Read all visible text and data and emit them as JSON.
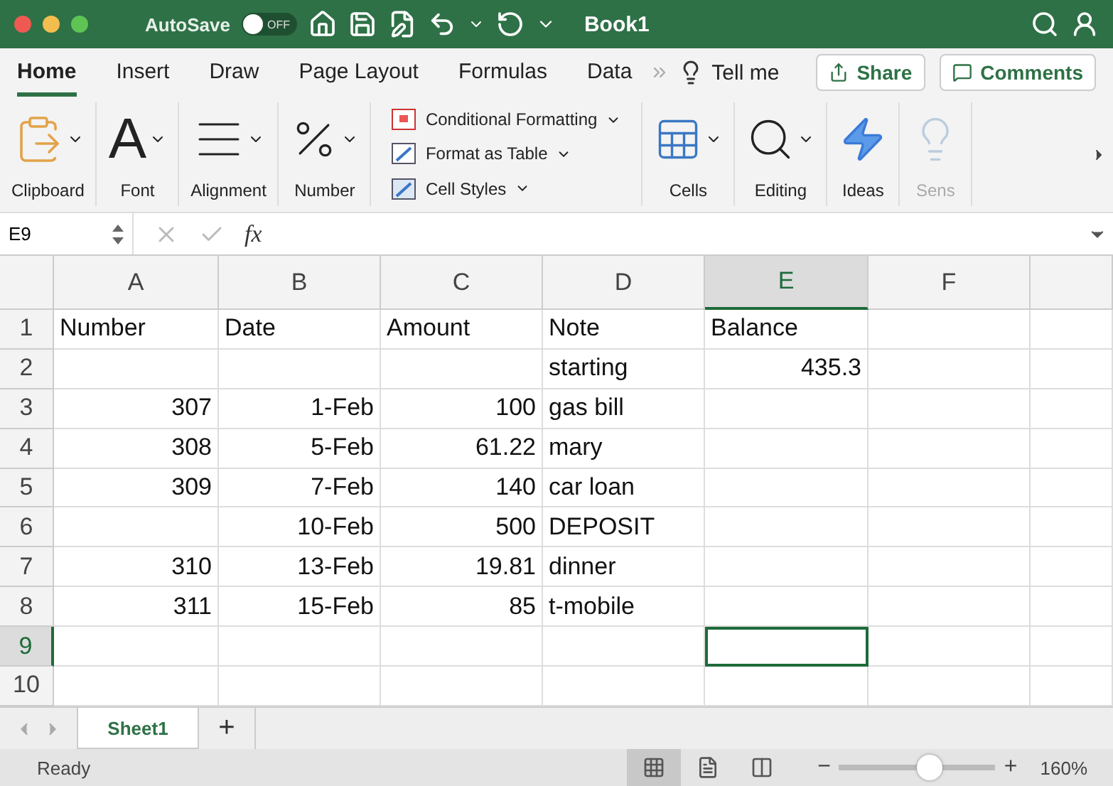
{
  "title_bar": {
    "autosave_label": "AutoSave",
    "autosave_toggle": {
      "label": "OFF",
      "on": false
    },
    "title": "Book1"
  },
  "menu_tabs": [
    {
      "label": "Home",
      "selected": true
    },
    {
      "label": "Insert",
      "selected": false
    },
    {
      "label": "Draw",
      "selected": false
    },
    {
      "label": "Page Layout",
      "selected": false
    },
    {
      "label": "Formulas",
      "selected": false
    },
    {
      "label": "Data",
      "selected": false
    }
  ],
  "tell_me": "Tell me",
  "share_button": "Share",
  "comments_button": "Comments",
  "ribbon": {
    "left_groups": [
      {
        "label": "Clipboard",
        "kind": "clipboard",
        "disabled": false
      },
      {
        "label": "Font",
        "kind": "font",
        "glyph": "A",
        "disabled": false
      },
      {
        "label": "Alignment",
        "kind": "alignment",
        "disabled": false
      },
      {
        "label": "Number",
        "kind": "number",
        "disabled": false
      }
    ],
    "styles": [
      {
        "label": "Conditional Formatting",
        "kind": "conditional"
      },
      {
        "label": "Format as Table",
        "kind": "table"
      },
      {
        "label": "Cell Styles",
        "kind": "styles"
      }
    ],
    "right_groups": [
      {
        "label": "Cells",
        "kind": "cells",
        "disabled": false
      },
      {
        "label": "Editing",
        "kind": "editing",
        "disabled": false
      },
      {
        "label": "Ideas",
        "kind": "ideas",
        "disabled": false
      },
      {
        "label": "Sens",
        "kind": "sens",
        "disabled": true
      }
    ]
  },
  "formula_bar": {
    "name_box": "E9",
    "fx": "fx"
  },
  "sheet": {
    "columns": [
      {
        "label": "A",
        "selected": false
      },
      {
        "label": "B",
        "selected": false
      },
      {
        "label": "C",
        "selected": false
      },
      {
        "label": "D",
        "selected": false
      },
      {
        "label": "E",
        "selected": true
      },
      {
        "label": "F",
        "selected": false
      }
    ],
    "rows": [
      {
        "label": "1",
        "selected": false,
        "cells": [
          {
            "text": "Number",
            "kind": "text",
            "selected": false
          },
          {
            "text": "Date",
            "kind": "text",
            "selected": false
          },
          {
            "text": "Amount",
            "kind": "text",
            "selected": false
          },
          {
            "text": "Note",
            "kind": "text",
            "selected": false
          },
          {
            "text": "Balance",
            "kind": "text",
            "selected": false
          },
          {
            "selected": false
          }
        ]
      },
      {
        "label": "2",
        "selected": false,
        "cells": [
          {
            "selected": false
          },
          {
            "selected": false
          },
          {
            "selected": false
          },
          {
            "text": "starting",
            "kind": "text",
            "selected": false
          },
          {
            "text": "435.3",
            "kind": "number",
            "selected": false
          },
          {
            "selected": false
          }
        ]
      },
      {
        "label": "3",
        "selected": false,
        "cells": [
          {
            "text": "307",
            "kind": "number",
            "selected": false
          },
          {
            "text": "1-Feb",
            "kind": "number",
            "selected": false
          },
          {
            "text": "100",
            "kind": "number",
            "selected": false
          },
          {
            "text": "gas bill",
            "kind": "text",
            "selected": false
          },
          {
            "selected": false
          },
          {
            "selected": false
          }
        ]
      },
      {
        "label": "4",
        "selected": false,
        "cells": [
          {
            "text": "308",
            "kind": "number",
            "selected": false
          },
          {
            "text": "5-Feb",
            "kind": "number",
            "selected": false
          },
          {
            "text": "61.22",
            "kind": "number",
            "selected": false
          },
          {
            "text": "mary",
            "kind": "text",
            "selected": false
          },
          {
            "selected": false
          },
          {
            "selected": false
          }
        ]
      },
      {
        "label": "5",
        "selected": false,
        "cells": [
          {
            "text": "309",
            "kind": "number",
            "selected": false
          },
          {
            "text": "7-Feb",
            "kind": "number",
            "selected": false
          },
          {
            "text": "140",
            "kind": "number",
            "selected": false
          },
          {
            "text": "car loan",
            "kind": "text",
            "selected": false
          },
          {
            "selected": false
          },
          {
            "selected": false
          }
        ]
      },
      {
        "label": "6",
        "selected": false,
        "cells": [
          {
            "selected": false
          },
          {
            "text": "10-Feb",
            "kind": "number",
            "selected": false
          },
          {
            "text": "500",
            "kind": "number",
            "selected": false
          },
          {
            "text": "DEPOSIT",
            "kind": "text",
            "selected": false
          },
          {
            "selected": false
          },
          {
            "selected": false
          }
        ]
      },
      {
        "label": "7",
        "selected": false,
        "cells": [
          {
            "text": "310",
            "kind": "number",
            "selected": false
          },
          {
            "text": "13-Feb",
            "kind": "number",
            "selected": false
          },
          {
            "text": "19.81",
            "kind": "number",
            "selected": false
          },
          {
            "text": "dinner",
            "kind": "text",
            "selected": false
          },
          {
            "selected": false
          },
          {
            "selected": false
          }
        ]
      },
      {
        "label": "8",
        "selected": false,
        "cells": [
          {
            "text": "311",
            "kind": "number",
            "selected": false
          },
          {
            "text": "15-Feb",
            "kind": "number",
            "selected": false
          },
          {
            "text": "85",
            "kind": "number",
            "selected": false
          },
          {
            "text": "t-mobile",
            "kind": "text",
            "selected": false
          },
          {
            "selected": false
          },
          {
            "selected": false
          }
        ]
      },
      {
        "label": "9",
        "selected": true,
        "cells": [
          {
            "selected": false
          },
          {
            "selected": false
          },
          {
            "selected": false
          },
          {
            "selected": false
          },
          {
            "selected": true
          },
          {
            "selected": false
          }
        ]
      },
      {
        "label": "10",
        "selected": false,
        "cells": [
          {
            "selected": false
          },
          {
            "selected": false
          },
          {
            "selected": false
          },
          {
            "selected": false
          },
          {
            "selected": false
          },
          {
            "selected": false
          }
        ]
      }
    ]
  },
  "sheet_tabs": [
    {
      "label": "Sheet1",
      "selected": true
    }
  ],
  "add_sheet": "+",
  "status_bar": {
    "status": "Ready",
    "view_modes": [
      {
        "kind": "normal",
        "selected": true
      },
      {
        "kind": "page_layout",
        "selected": false
      },
      {
        "kind": "page_break",
        "selected": false
      }
    ],
    "zoom_out": "−",
    "zoom_in": "+",
    "zoom": {
      "level": 0.58
    },
    "zoom_label": "160%"
  }
}
